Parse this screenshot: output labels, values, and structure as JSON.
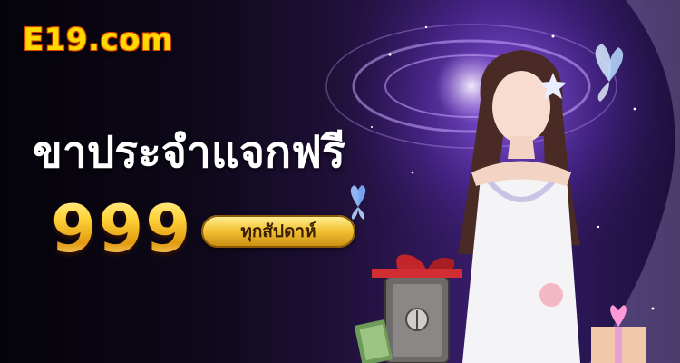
{
  "brand": {
    "logo_text": "E19.com"
  },
  "promo": {
    "headline": "ขาประจำแจกฟรี",
    "amount": "999",
    "period": "ทุกสัปดาห์"
  },
  "colors": {
    "logo_yellow": "#ffd800",
    "gold": "#f4c537",
    "purple": "#3a1d6e"
  },
  "illustrations": [
    "galaxy-swirl",
    "butterfly",
    "model-in-white-dress",
    "safe",
    "cash-stack",
    "gift-box"
  ]
}
